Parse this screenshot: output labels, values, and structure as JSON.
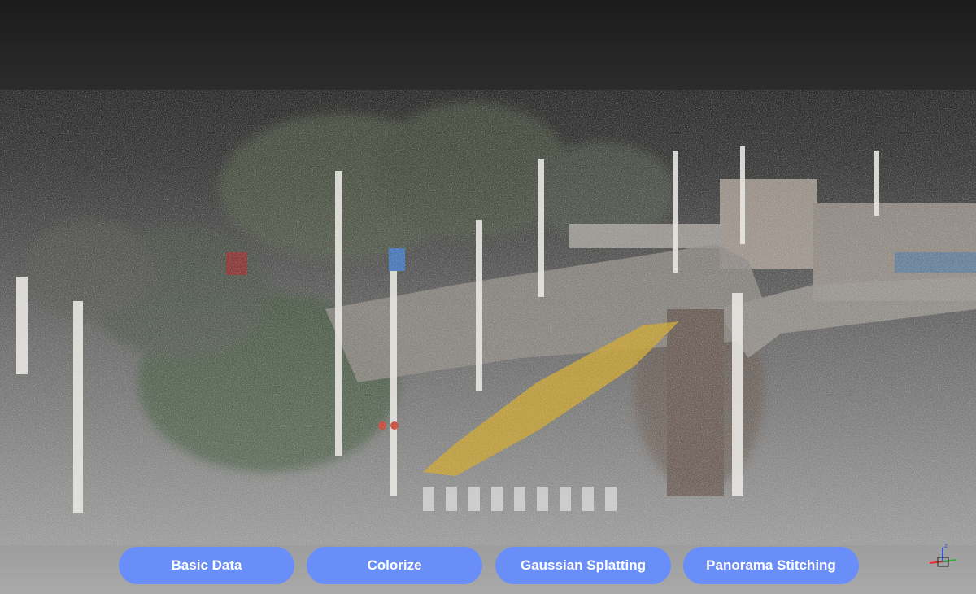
{
  "viewer": {
    "background_top": "#1b1b1b",
    "background_bottom": "#a9a9a9",
    "render_mode": "point-cloud"
  },
  "mode_bar": {
    "accent": "#6a8ef7",
    "buttons": [
      {
        "label": "Basic Data"
      },
      {
        "label": "Colorize"
      },
      {
        "label": "Gaussian Splatting"
      },
      {
        "label": "Panorama Stitching"
      }
    ]
  },
  "axis_gizmo": {
    "icon": "axis-orientation-icon",
    "z_label": "z",
    "colors": {
      "x": "#e03030",
      "y": "#30b040",
      "z": "#3050e0"
    }
  }
}
